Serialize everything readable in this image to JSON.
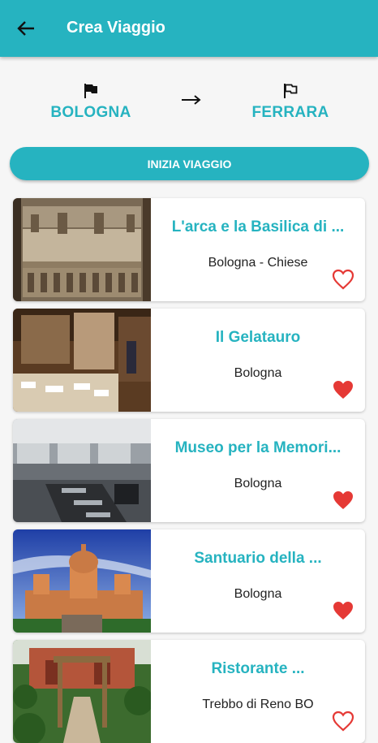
{
  "appbar": {
    "title": "Crea Viaggio"
  },
  "route": {
    "start": "BOLOGNA",
    "end": "FERRARA"
  },
  "actions": {
    "start_trip": "INIZIA VIAGGIO"
  },
  "colors": {
    "accent": "#26b3c0",
    "favorite": "#e53935"
  },
  "places": [
    {
      "title": "L'arca e la Basilica di ...",
      "subtitle": "Bologna - Chiese",
      "favorite": false
    },
    {
      "title": "Il Gelatauro",
      "subtitle": "Bologna",
      "favorite": true
    },
    {
      "title": "Museo per la Memori...",
      "subtitle": "Bologna",
      "favorite": true
    },
    {
      "title": "Santuario della ...",
      "subtitle": "Bologna",
      "favorite": true
    },
    {
      "title": "Ristorante ...",
      "subtitle": "Trebbo di Reno BO",
      "favorite": false
    }
  ]
}
